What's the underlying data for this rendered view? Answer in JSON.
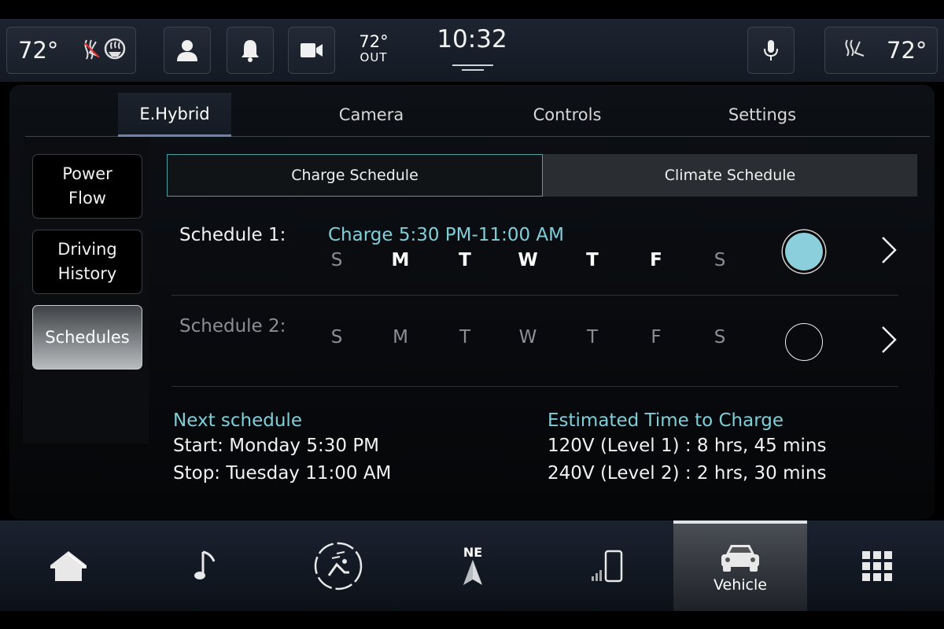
{
  "status_bar": {
    "driver_temp": "72°",
    "passenger_temp": "72°",
    "outside_temp": "72°",
    "outside_label": "OUT",
    "clock": "10:32"
  },
  "tabs": [
    {
      "label": "E.Hybrid",
      "active": true
    },
    {
      "label": "Camera",
      "active": false
    },
    {
      "label": "Controls",
      "active": false
    },
    {
      "label": "Settings",
      "active": false
    }
  ],
  "sidebar": [
    {
      "label": "Power\nFlow",
      "active": false
    },
    {
      "label": "Driving\nHistory",
      "active": false
    },
    {
      "label": "Schedules",
      "active": true
    }
  ],
  "segments": {
    "charge": "Charge Schedule",
    "climate": "Climate Schedule"
  },
  "schedules": [
    {
      "label": "Schedule 1:",
      "time": "Charge 5:30 PM-11:00 AM",
      "days": [
        "S",
        "M",
        "T",
        "W",
        "T",
        "F",
        "S"
      ],
      "active_days": [
        false,
        true,
        true,
        true,
        true,
        true,
        false
      ],
      "enabled": true
    },
    {
      "label": "Schedule 2:",
      "time": "",
      "days": [
        "S",
        "M",
        "T",
        "W",
        "T",
        "F",
        "S"
      ],
      "active_days": [
        false,
        false,
        false,
        false,
        false,
        false,
        false
      ],
      "enabled": false
    }
  ],
  "next_schedule": {
    "title": "Next schedule",
    "start": "Start: Monday 5:30 PM",
    "stop": "Stop: Tuesday 11:00 AM"
  },
  "estimate": {
    "title": "Estimated Time to Charge",
    "level1": "120V (Level 1) : 8 hrs, 45 mins",
    "level2": "240V (Level 2) : 2 hrs, 30 mins"
  },
  "bottom_nav": {
    "compass": "NE",
    "vehicle_label": "Vehicle"
  },
  "colors": {
    "accent_teal": "#7fcfda",
    "toggle_on": "#8ccfdc"
  }
}
